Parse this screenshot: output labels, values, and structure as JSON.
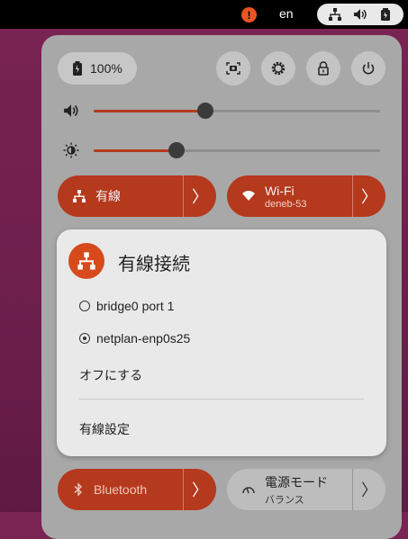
{
  "topbar": {
    "language": "en",
    "icons": [
      "alert-icon",
      "network-icon",
      "volume-icon",
      "battery-icon"
    ]
  },
  "quick_settings": {
    "battery_label": "100%",
    "volume_level": 0.39,
    "brightness_level": 0.29,
    "wired_toggle": {
      "label": "有線",
      "on": true
    },
    "wifi_toggle": {
      "label": "Wi-Fi",
      "sublabel": "deneb-53",
      "on": true
    },
    "bluetooth_toggle": {
      "label": "Bluetooth",
      "on": true
    },
    "power_mode_toggle": {
      "label": "電源モード",
      "sublabel": "バランス",
      "on": false
    }
  },
  "wired_menu": {
    "title": "有線接続",
    "connections": [
      {
        "label": "bridge0 port 1",
        "selected": false
      },
      {
        "label": "netplan-enp0s25",
        "selected": true
      }
    ],
    "turn_off_label": "オフにする",
    "settings_label": "有線設定"
  },
  "colors": {
    "accent": "#b5391d",
    "accent_bright": "#e95420",
    "panel": "#a8a8a8",
    "submenu": "#e9e9e9"
  }
}
